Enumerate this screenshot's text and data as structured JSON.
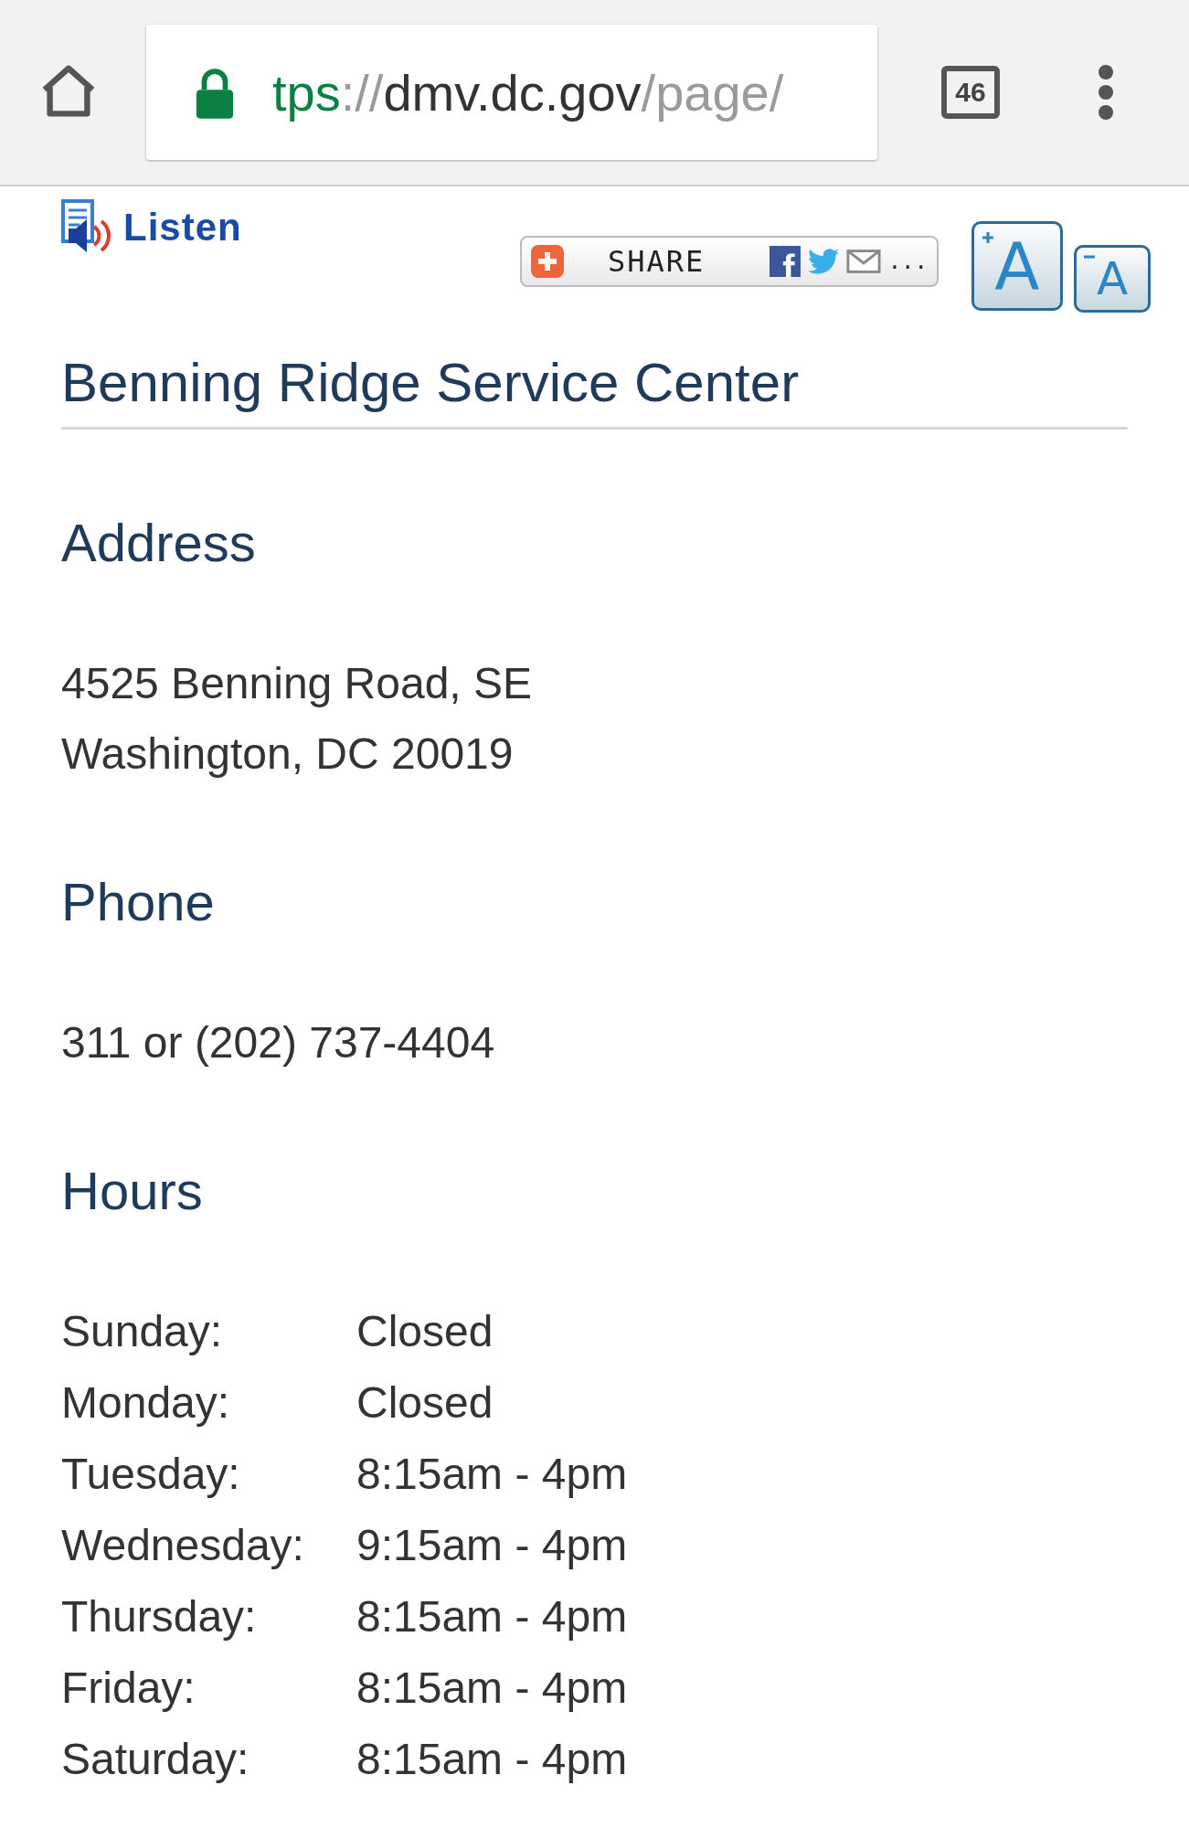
{
  "browser": {
    "url": [
      {
        "kind": "scheme",
        "text": "tps"
      },
      {
        "kind": "muted",
        "text": "://"
      },
      {
        "kind": "host",
        "text": "dmv.dc.gov"
      },
      {
        "kind": "muted",
        "text": "/page/"
      }
    ],
    "secure": true,
    "tab_count": "46"
  },
  "toolbar": {
    "listen": "Listen",
    "share": "SHARE",
    "share_more": "...",
    "font_larger": "A",
    "font_smaller": "A"
  },
  "title": "Benning Ridge Service Center",
  "sections": [
    {
      "heading": "Address",
      "kind": "lines",
      "lines": [
        "4525 Benning Road, SE",
        "Washington, DC 20019"
      ]
    },
    {
      "heading": "Phone",
      "kind": "lines",
      "lines": [
        "311 or (202) 737-4404"
      ]
    },
    {
      "heading": "Hours",
      "kind": "hours",
      "rows": [
        {
          "day": "Sunday:",
          "time": "Closed"
        },
        {
          "day": "Monday:",
          "time": "Closed"
        },
        {
          "day": "Tuesday:",
          "time": "8:15am - 4pm"
        },
        {
          "day": "Wednesday:",
          "time": "9:15am - 4pm"
        },
        {
          "day": "Thursday:",
          "time": "8:15am - 4pm"
        },
        {
          "day": "Friday:",
          "time": "8:15am - 4pm"
        },
        {
          "day": "Saturday:",
          "time": "8:15am - 4pm"
        }
      ]
    }
  ]
}
